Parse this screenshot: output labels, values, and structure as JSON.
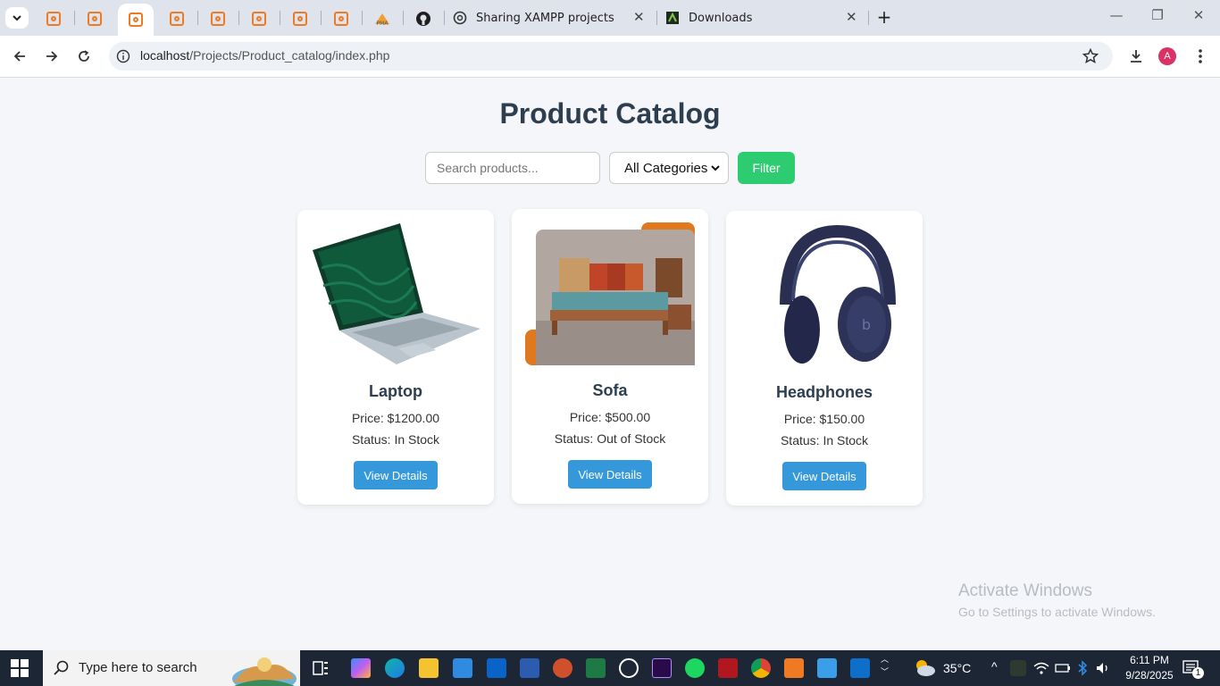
{
  "browser": {
    "tabs": [
      {
        "title": "Sharing XAMPP projects",
        "icon": "chatgpt-icon"
      },
      {
        "title": "Downloads",
        "icon": "downloads-icon"
      }
    ],
    "address_bar": {
      "host": "localhost",
      "path": "/Projects/Product_catalog/index.php"
    },
    "profile_initial": "A"
  },
  "page": {
    "title": "Product Catalog",
    "search": {
      "placeholder": "Search products..."
    },
    "category": {
      "selected": "All Categories"
    },
    "filter_label": "Filter",
    "products": [
      {
        "name": "Laptop",
        "price": "Price: $1200.00",
        "status": "Status: In Stock",
        "button": "View Details",
        "image": "laptop-image"
      },
      {
        "name": "Sofa",
        "price": "Price: $500.00",
        "status": "Status: Out of Stock",
        "button": "View Details",
        "image": "sofa-image"
      },
      {
        "name": "Headphones",
        "price": "Price: $150.00",
        "status": "Status: In Stock",
        "button": "View Details",
        "image": "headphones-image"
      }
    ]
  },
  "watermark": {
    "line1": "Activate Windows",
    "line2": "Go to Settings to activate Windows."
  },
  "taskbar": {
    "search_placeholder": "Type here to search",
    "weather": "35°C",
    "time": "6:11 PM",
    "date": "9/28/2025",
    "notification_count": "1"
  },
  "colors": {
    "accent_green": "#2ecc71",
    "accent_blue": "#3498db",
    "title": "#2c3e50",
    "xampp_orange": "#f07a24"
  }
}
